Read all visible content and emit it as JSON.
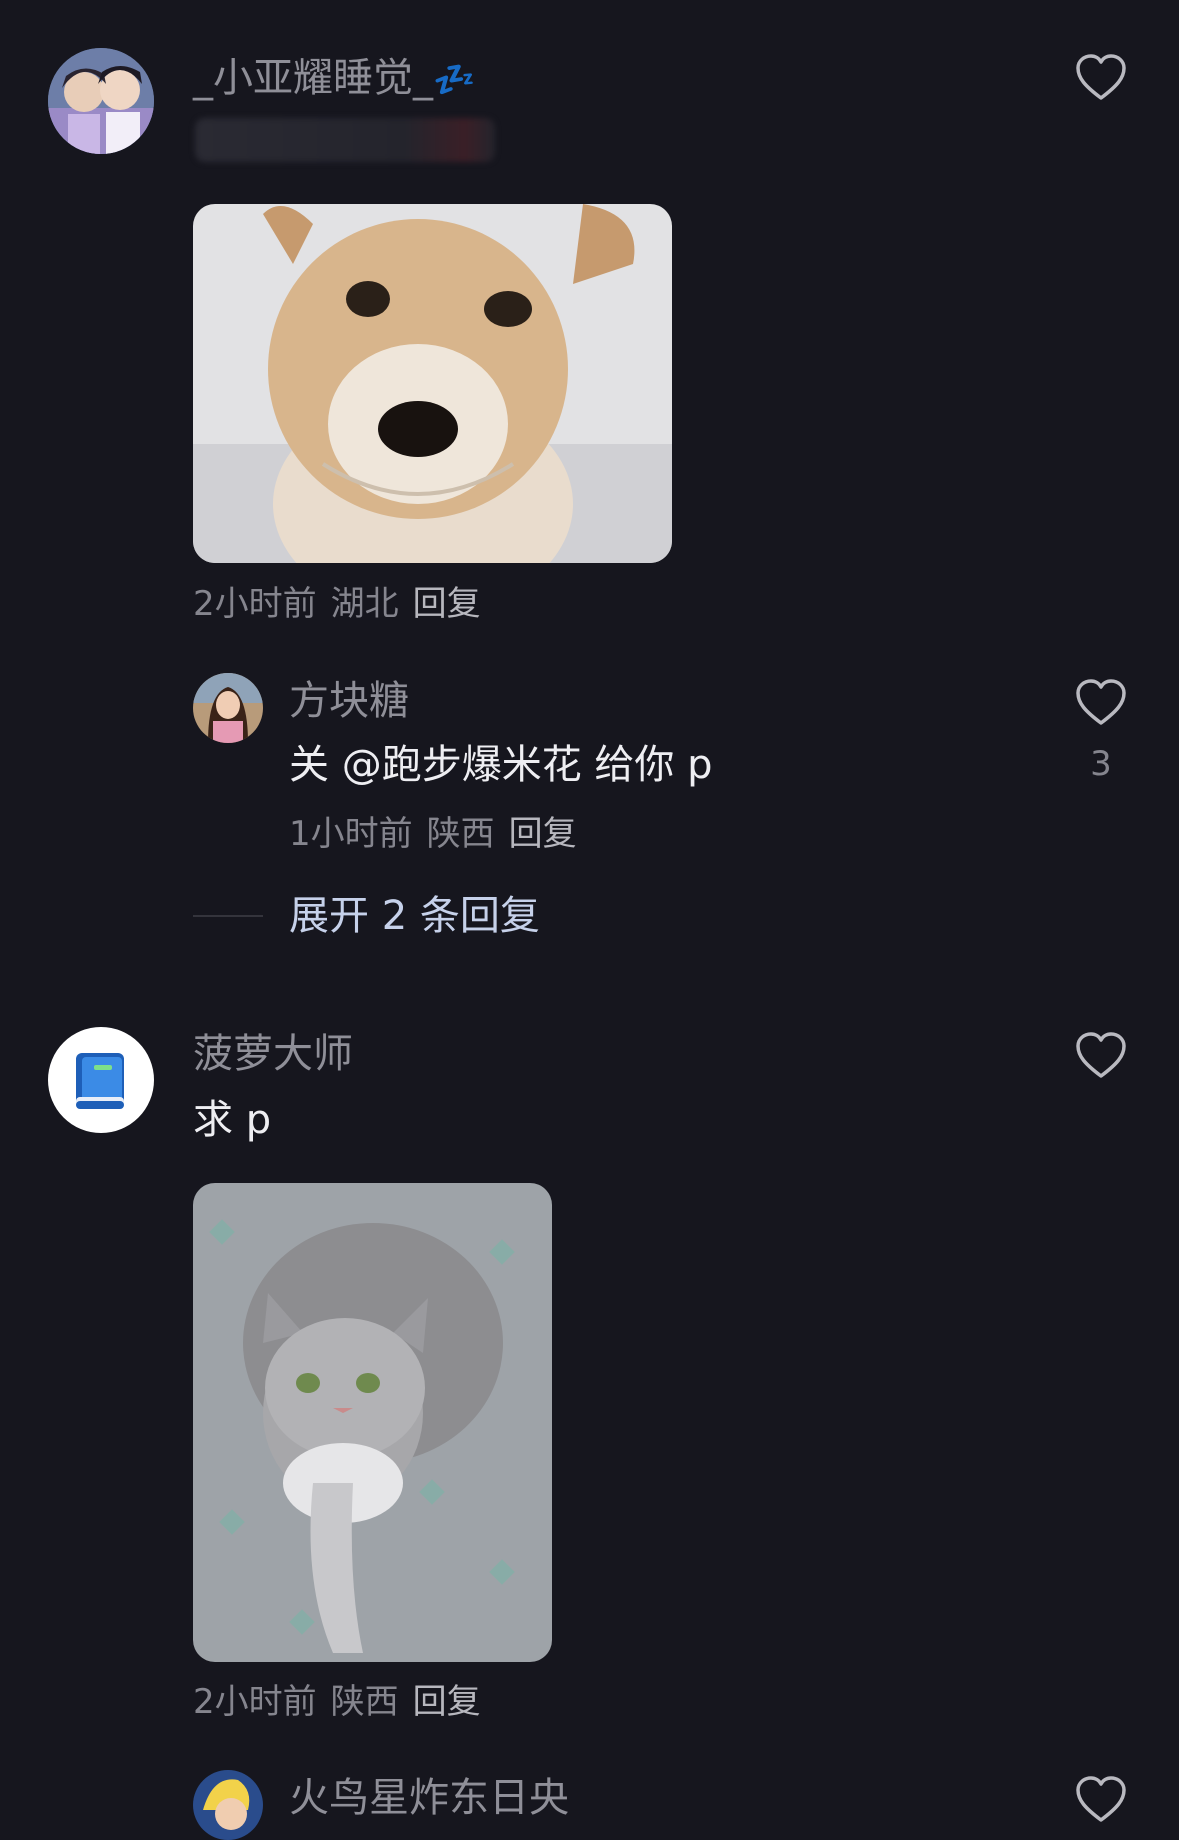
{
  "comments": [
    {
      "username": "_小亚耀睡觉_",
      "username_emoji": "💤",
      "time": "2小时前",
      "location": "湖北",
      "reply_label": "回复",
      "photo_subject": "puppy"
    },
    {
      "username": "菠萝大师",
      "text": "求 p",
      "time": "2小时前",
      "location": "陕西",
      "reply_label": "回复",
      "photo_subject": "cat"
    },
    {
      "username": "火鸟星炸东日央"
    }
  ],
  "replies": [
    {
      "username": "方块糖",
      "text": "关 @跑步爆米花 给你 p",
      "time": "1小时前",
      "location": "陕西",
      "reply_label": "回复",
      "like_count": "3"
    }
  ],
  "expand_label": "展开 2 条回复",
  "icons": {
    "like": "heart-outline-icon",
    "avatar_book": "blue-book-icon"
  },
  "colors": {
    "background": "#16161e",
    "secondary_text": "#8f8f98",
    "expand_text": "#c6d1ea"
  }
}
